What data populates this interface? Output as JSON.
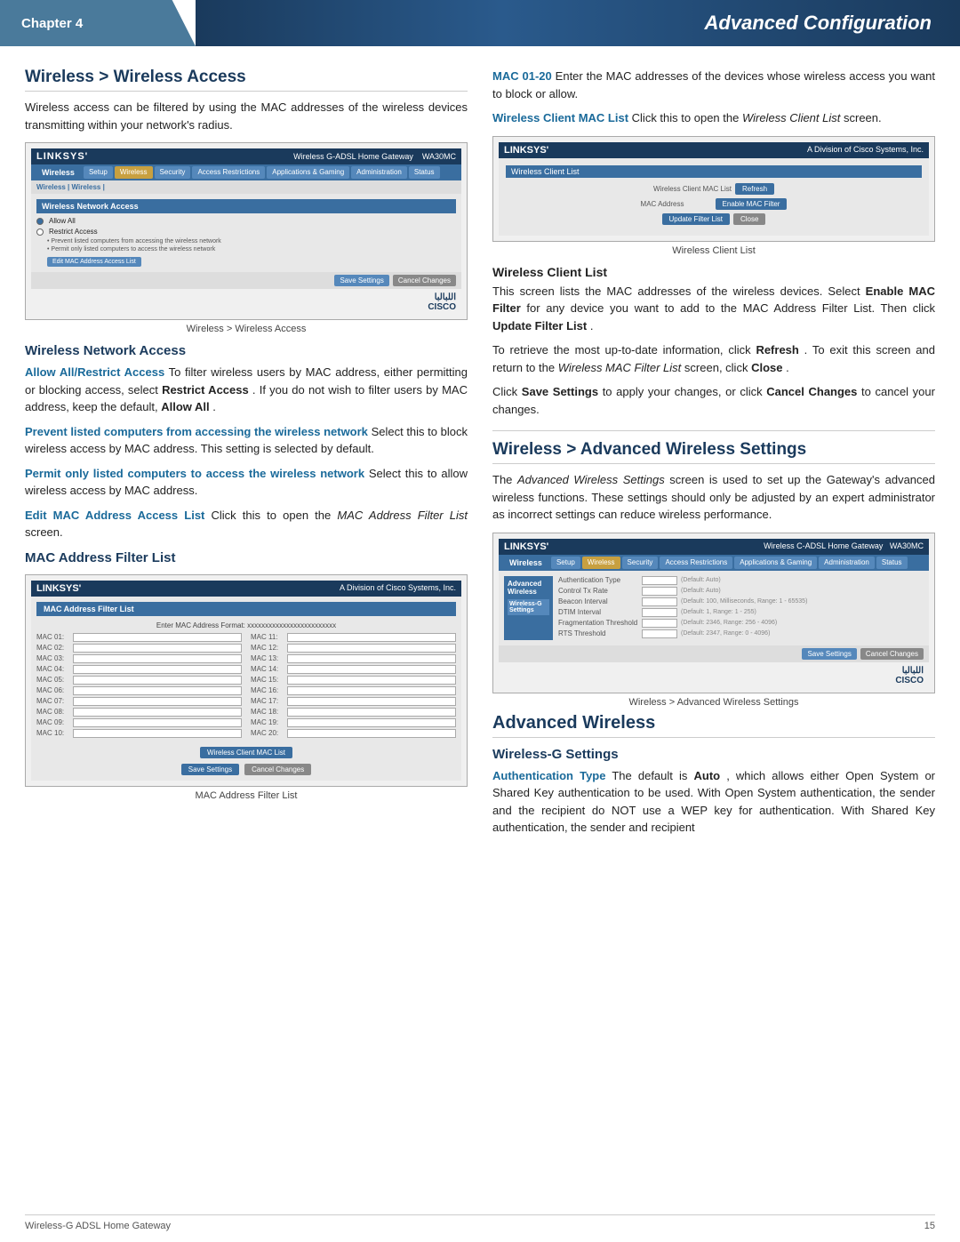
{
  "header": {
    "chapter_label": "Chapter 4",
    "title": "Advanced Configuration"
  },
  "left_col": {
    "section1_title": "Wireless > Wireless Access",
    "section1_intro": "Wireless access can be filtered by using the MAC addresses of the wireless devices transmitting within your network's radius.",
    "screenshot1_caption": "Wireless > Wireless Access",
    "subsection1_title": "Wireless Network Access",
    "allow_heading": "Allow All/Restrict Access",
    "allow_text": " To filter wireless users by MAC address, either permitting or blocking access, select ",
    "restrict_bold": "Restrict Access",
    "allow_text2": ". If you do not wish to filter users by MAC address, keep the default, ",
    "allow_all_bold": "Allow All",
    "allow_text3": ".",
    "prevent_heading": "Prevent listed computers from accessing the wireless network",
    "prevent_text": " Select this to block wireless access by MAC address. This setting is selected by default.",
    "permit_heading": "Permit only listed computers to access the wireless network",
    "permit_text": " Select this to allow wireless access by MAC address.",
    "edit_heading": "Edit MAC Address Access List",
    "edit_text": " Click this to open the ",
    "edit_italic": "MAC Address Filter List",
    "edit_text2": " screen.",
    "mac_filter_title": "MAC Address Filter List",
    "mac_caption": "MAC Address Filter List",
    "mac_format": "Enter MAC Address Format: xxxxxxxxxxxxxxxxxxxxxxxxx",
    "mac_labels": [
      "MAC 01:",
      "MAC 11:",
      "MAC 02:",
      "MAC 12:",
      "MAC 03:",
      "MAC 13:",
      "MAC 04:",
      "MAC 14:",
      "MAC 05:",
      "MAC 15:",
      "MAC 06:",
      "MAC 16:",
      "MAC 07:",
      "MAC 17:",
      "MAC 08:",
      "MAC 18:",
      "MAC 09:",
      "MAC 19:",
      "MAC 10:",
      "MAC 20:"
    ],
    "wcl_btn": "Wireless Client MAC List",
    "save_btn": "Save Settings",
    "cancel_btn": "Cancel Changes"
  },
  "right_col": {
    "mac_01_20_heading": "MAC 01-20",
    "mac_01_20_text": " Enter the MAC addresses of the devices whose wireless access you want to block or allow.",
    "wcl_heading": "Wireless Client MAC List",
    "wcl_text": " Click this to open the ",
    "wcl_italic": "Wireless Client List",
    "wcl_text2": " screen.",
    "wcl_caption": "Wireless Client List",
    "wcl_section_title": "Wireless Client List",
    "wcl_body1": "This screen lists the MAC addresses of the wireless devices. Select ",
    "enable_bold": "Enable MAC Filter",
    "wcl_body2": " for any device you want to add to the MAC Address Filter List. Then click ",
    "update_bold": "Update Filter List",
    "wcl_body3": ".",
    "wcl_body4": "To retrieve the most up-to-date information, click ",
    "refresh_bold": "Refresh",
    "wcl_body5": ". To exit this screen and return to the ",
    "wcl_italic2": "Wireless MAC Filter List",
    "wcl_body6": " screen, click ",
    "close_bold": "Close",
    "wcl_body7": ".",
    "save_text": "Click ",
    "save_bold": "Save Settings",
    "save_text2": " to apply your changes, or click ",
    "cancel_bold": "Cancel Changes",
    "save_text3": " to cancel your changes.",
    "section2_title": "Wireless > Advanced Wireless Settings",
    "section2_intro": "The ",
    "section2_italic": "Advanced Wireless Settings",
    "section2_text": " screen is used to set up the Gateway's advanced wireless functions. These settings should only be adjusted by an expert administrator as incorrect settings can reduce wireless performance.",
    "aw_caption": "Wireless > Advanced Wireless Settings",
    "advanced_title": "Advanced Wireless",
    "wg_title": "Wireless-G Settings",
    "auth_heading": "Authentication Type",
    "auth_text": " The default is ",
    "auto_bold": "Auto",
    "auth_text2": ", which allows either Open System or Shared Key authentication to be used. With Open System authentication, the sender and the recipient do NOT use a WEP key for authentication. With Shared Key authentication, the sender and recipient"
  },
  "footer": {
    "left": "Wireless-G ADSL Home Gateway",
    "right": "15"
  },
  "colors": {
    "header_dark": "#1a3a5c",
    "header_medium": "#3a6ea0",
    "highlight": "#1a6a9a",
    "chapter_bg": "#4a7a9b"
  }
}
